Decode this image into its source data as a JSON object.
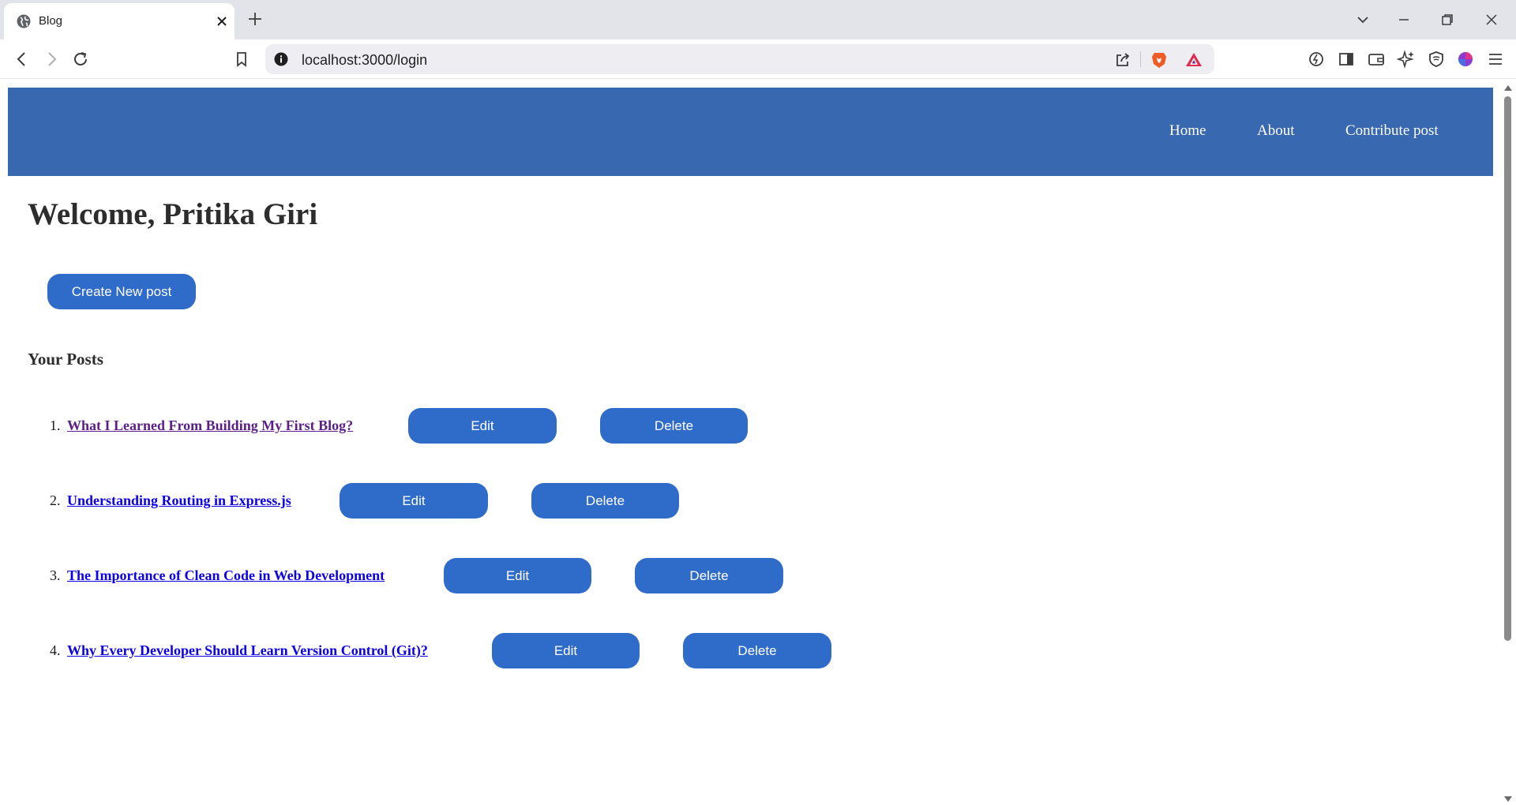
{
  "browser": {
    "tab": {
      "title": "Blog",
      "favicon": "globe-icon"
    },
    "url": "localhost:3000/login",
    "brand_color": "#f05a24"
  },
  "page": {
    "nav": {
      "home": "Home",
      "about": "About",
      "contribute": "Contribute post"
    },
    "welcome": "Welcome, Pritika Giri",
    "create_button": "Create New post",
    "section_title": "Your Posts",
    "colors": {
      "header": "#3868b0",
      "button": "#2f6bc8",
      "visited_link": "#5b1f87",
      "link": "#0b00e6"
    },
    "posts": [
      {
        "number": "1.",
        "title": "What I Learned From Building My First Blog?",
        "visited": true,
        "edit": "Edit",
        "delete": "Delete"
      },
      {
        "number": "2.",
        "title": "Understanding Routing in Express.js",
        "visited": false,
        "edit": "Edit",
        "delete": "Delete"
      },
      {
        "number": "3.",
        "title": "The Importance of Clean Code in Web Development",
        "visited": false,
        "edit": "Edit",
        "delete": "Delete"
      },
      {
        "number": "4.",
        "title": "Why Every Developer Should Learn Version Control (Git)?",
        "visited": false,
        "edit": "Edit",
        "delete": "Delete"
      }
    ]
  }
}
